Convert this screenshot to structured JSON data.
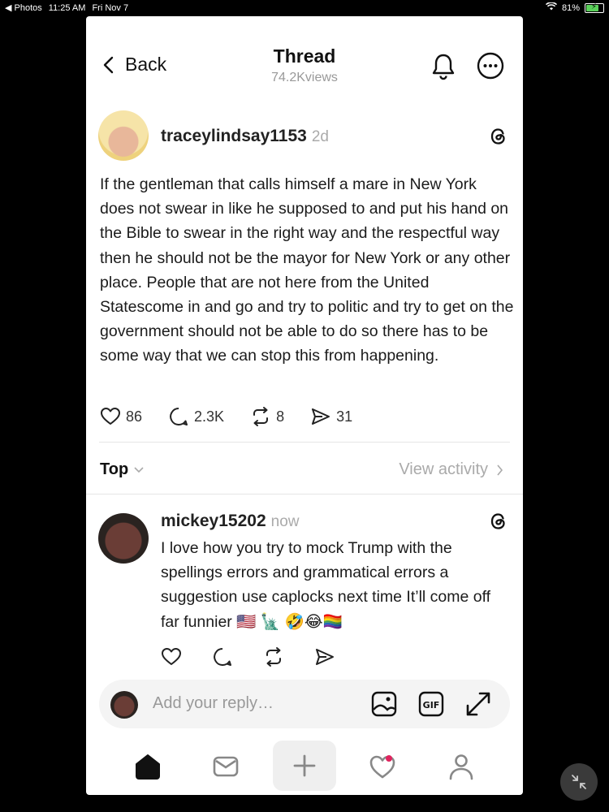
{
  "status_bar": {
    "back_app": "◀ Photos",
    "time": "11:25 AM",
    "date": "Fri Nov 7",
    "battery": "81%",
    "battery_level": 0.81
  },
  "header": {
    "back_label": "Back",
    "title": "Thread",
    "views": "74.2Kviews"
  },
  "post": {
    "username": "traceylindsay1153",
    "time": "2d",
    "text": "If the gentleman that calls himself a mare in New York does not swear in like he supposed to and put his hand on the Bible to swear in the right way and the respectful way then he should not be the mayor for New York or any other place. People that are not here from the United Statescome in and go and try to politic and try to get on the government should not be able to do so there has to be some way that we can stop this from happening.",
    "likes": "86",
    "comments": "2.3K",
    "reposts": "8",
    "shares": "31"
  },
  "sort": {
    "label": "Top",
    "view_activity": "View activity"
  },
  "reply": {
    "username": "mickey15202",
    "time": "now",
    "text": "I love how you try to mock Trump with the spellings errors  and grammatical errors a suggestion use caplocks next time It’ll come off far funnier 🇺🇸 🗽 🤣😂🏳️‍🌈"
  },
  "reply_box": {
    "placeholder": "Add your reply…"
  },
  "icons": {
    "back": "chevron-left-icon",
    "bell": "bell-icon",
    "more": "more-icon",
    "threads": "threads-logo-icon",
    "heart": "heart-icon",
    "comment": "comment-icon",
    "repost": "repost-icon",
    "share": "send-icon",
    "image": "image-icon",
    "gif": "gif-icon",
    "expand": "expand-icon",
    "home": "home-icon",
    "messages": "messages-icon",
    "create": "plus-icon",
    "activity": "activity-heart-icon",
    "profile": "profile-icon",
    "pip": "collapse-icon"
  },
  "colors": {
    "accent_notification": "#e0245e",
    "muted_text": "#999999"
  }
}
